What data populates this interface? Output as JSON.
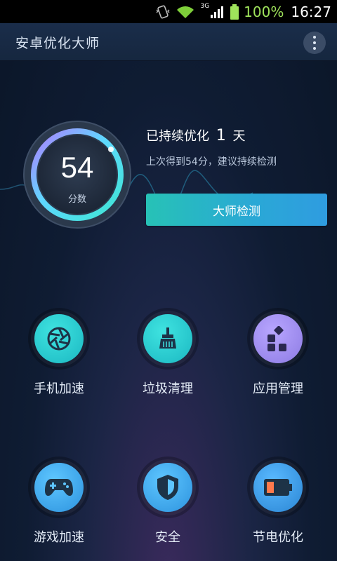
{
  "status_bar": {
    "battery_percent": "100%",
    "time": "16:27",
    "network": "3G"
  },
  "app_bar": {
    "title": "安卓优化大师"
  },
  "score": {
    "value": "54",
    "label": "分数"
  },
  "summary": {
    "days_prefix": "已持续优化",
    "days_count": "1",
    "days_suffix": "天",
    "last_score_text": "上次得到54分，建议持续检测",
    "check_button": "大师检测"
  },
  "tools": [
    {
      "label": "手机加速",
      "icon": "aperture-icon"
    },
    {
      "label": "垃圾清理",
      "icon": "broom-icon"
    },
    {
      "label": "应用管理",
      "icon": "apps-grid-icon"
    },
    {
      "label": "游戏加速",
      "icon": "gamepad-icon"
    },
    {
      "label": "安全",
      "icon": "shield-icon"
    },
    {
      "label": "节电优化",
      "icon": "battery-icon"
    }
  ],
  "colors": {
    "teal": "#27c2b6",
    "purple": "#9c8af0",
    "blue": "#2f9ce0",
    "battery_green": "#9fe35b"
  }
}
